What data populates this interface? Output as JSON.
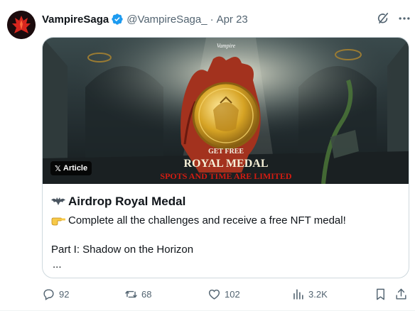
{
  "author": {
    "name": "VampireSaga",
    "handle": "@VampireSaga_",
    "separator": "·",
    "date": "Apr 23"
  },
  "card": {
    "badge_label": "Article",
    "image_texts": {
      "logo": "Vampire",
      "get_free": "GET FREE",
      "medal_name": "ROYAL MEDAL",
      "limited": "SPOTS AND TIME ARE LIMITED"
    },
    "title": "Airdrop Royal Medal",
    "line1": "Complete all the challenges and receive a free NFT medal!",
    "line2": "Part I: Shadow on the Horizon",
    "ellipsis": "..."
  },
  "actions": {
    "replies": "92",
    "reposts": "68",
    "likes": "102",
    "views": "3.2K"
  },
  "colors": {
    "verified": "#1d9bf0",
    "secondary_text": "#536471",
    "border": "#cfd9de"
  }
}
